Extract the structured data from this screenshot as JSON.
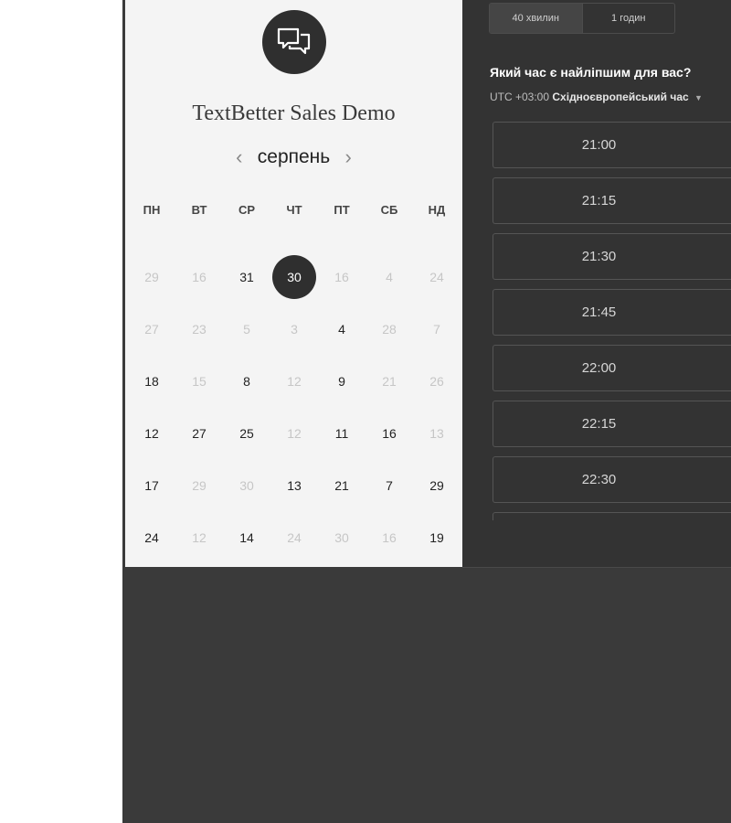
{
  "event": {
    "title": "TextBetter Sales Demo",
    "logo_icon": "chat-bubbles-icon"
  },
  "calendar": {
    "month": "серпень",
    "prev_icon": "‹",
    "next_icon": "›",
    "weekdays": [
      "ПН",
      "ВТ",
      "СР",
      "ЧТ",
      "ПТ",
      "СБ",
      "НД"
    ],
    "rows": [
      [
        {
          "d": "29",
          "s": "unavail"
        },
        {
          "d": "16",
          "s": "unavail"
        },
        {
          "d": "31",
          "s": "avail"
        },
        {
          "d": "30",
          "s": "selected"
        },
        {
          "d": "16",
          "s": "unavail"
        },
        {
          "d": "4",
          "s": "unavail"
        },
        {
          "d": "24",
          "s": "unavail"
        }
      ],
      [
        {
          "d": "27",
          "s": "unavail"
        },
        {
          "d": "23",
          "s": "unavail"
        },
        {
          "d": "5",
          "s": "unavail"
        },
        {
          "d": "3",
          "s": "unavail"
        },
        {
          "d": "4",
          "s": "avail"
        },
        {
          "d": "28",
          "s": "unavail"
        },
        {
          "d": "7",
          "s": "unavail"
        }
      ],
      [
        {
          "d": "18",
          "s": "avail"
        },
        {
          "d": "15",
          "s": "unavail"
        },
        {
          "d": "8",
          "s": "avail"
        },
        {
          "d": "12",
          "s": "unavail"
        },
        {
          "d": "9",
          "s": "avail"
        },
        {
          "d": "21",
          "s": "unavail"
        },
        {
          "d": "26",
          "s": "unavail"
        }
      ],
      [
        {
          "d": "12",
          "s": "avail"
        },
        {
          "d": "27",
          "s": "avail"
        },
        {
          "d": "25",
          "s": "avail"
        },
        {
          "d": "12",
          "s": "unavail"
        },
        {
          "d": "11",
          "s": "avail"
        },
        {
          "d": "16",
          "s": "avail"
        },
        {
          "d": "13",
          "s": "unavail"
        }
      ],
      [
        {
          "d": "17",
          "s": "avail"
        },
        {
          "d": "29",
          "s": "unavail"
        },
        {
          "d": "30",
          "s": "unavail"
        },
        {
          "d": "13",
          "s": "avail"
        },
        {
          "d": "21",
          "s": "avail"
        },
        {
          "d": "7",
          "s": "avail"
        },
        {
          "d": "29",
          "s": "avail"
        }
      ],
      [
        {
          "d": "24",
          "s": "avail"
        },
        {
          "d": "12",
          "s": "unavail"
        },
        {
          "d": "14",
          "s": "avail"
        },
        {
          "d": "24",
          "s": "unavail"
        },
        {
          "d": "30",
          "s": "unavail"
        },
        {
          "d": "16",
          "s": "unavail"
        },
        {
          "d": "19",
          "s": "avail"
        }
      ]
    ]
  },
  "booking": {
    "durations": [
      "40 хвилин",
      "1 годин"
    ],
    "active_duration": 0,
    "question": "Який час є найліпшим для вас?",
    "timezone_offset": "UTC +03:00",
    "timezone_name": "Східноєвропейський час",
    "timezone_caret": "▼",
    "slots": [
      "21:00",
      "21:15",
      "21:30",
      "21:45",
      "22:00",
      "22:15",
      "22:30",
      ""
    ]
  },
  "colors": {
    "left_bg": "#f4f4f4",
    "right_bg": "#333333",
    "selected_day": "#2f2f2f"
  }
}
